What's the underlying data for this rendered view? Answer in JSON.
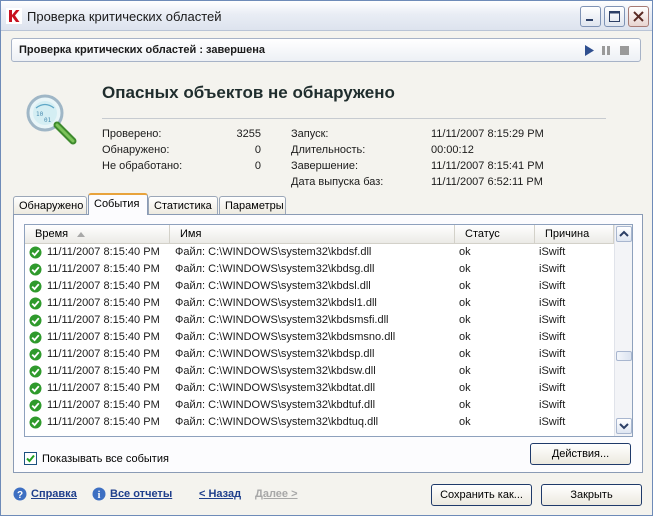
{
  "window": {
    "title": "Проверка критических областей"
  },
  "status": {
    "text": "Проверка критических областей : завершена"
  },
  "summary": {
    "headline": "Опасных объектов не обнаружено",
    "checked_label": "Проверено:",
    "checked_value": "3255",
    "found_label": "Обнаружено:",
    "found_value": "0",
    "unprocessed_label": "Не обработано:",
    "unprocessed_value": "0",
    "start_label": "Запуск:",
    "start_value": "11/11/2007 8:15:29 PM",
    "duration_label": "Длительность:",
    "duration_value": "00:00:12",
    "finish_label": "Завершение:",
    "finish_value": "11/11/2007 8:15:41 PM",
    "db_label": "Дата выпуска баз:",
    "db_value": "11/11/2007 6:52:11 PM"
  },
  "tabs": [
    {
      "label": "Обнаружено",
      "active": false
    },
    {
      "label": "События",
      "active": true
    },
    {
      "label": "Статистика",
      "active": false
    },
    {
      "label": "Параметры",
      "active": false
    }
  ],
  "table": {
    "columns": [
      "Время",
      "Имя",
      "Статус",
      "Причина"
    ],
    "rows": [
      {
        "time": "11/11/2007 8:15:40 PM",
        "name": "Файл: C:\\WINDOWS\\system32\\kbdsf.dll",
        "status": "ok",
        "reason": "iSwift"
      },
      {
        "time": "11/11/2007 8:15:40 PM",
        "name": "Файл: C:\\WINDOWS\\system32\\kbdsg.dll",
        "status": "ok",
        "reason": "iSwift"
      },
      {
        "time": "11/11/2007 8:15:40 PM",
        "name": "Файл: C:\\WINDOWS\\system32\\kbdsl.dll",
        "status": "ok",
        "reason": "iSwift"
      },
      {
        "time": "11/11/2007 8:15:40 PM",
        "name": "Файл: C:\\WINDOWS\\system32\\kbdsl1.dll",
        "status": "ok",
        "reason": "iSwift"
      },
      {
        "time": "11/11/2007 8:15:40 PM",
        "name": "Файл: C:\\WINDOWS\\system32\\kbdsmsfi.dll",
        "status": "ok",
        "reason": "iSwift"
      },
      {
        "time": "11/11/2007 8:15:40 PM",
        "name": "Файл: C:\\WINDOWS\\system32\\kbdsmsno.dll",
        "status": "ok",
        "reason": "iSwift"
      },
      {
        "time": "11/11/2007 8:15:40 PM",
        "name": "Файл: C:\\WINDOWS\\system32\\kbdsp.dll",
        "status": "ok",
        "reason": "iSwift"
      },
      {
        "time": "11/11/2007 8:15:40 PM",
        "name": "Файл: C:\\WINDOWS\\system32\\kbdsw.dll",
        "status": "ok",
        "reason": "iSwift"
      },
      {
        "time": "11/11/2007 8:15:40 PM",
        "name": "Файл: C:\\WINDOWS\\system32\\kbdtat.dll",
        "status": "ok",
        "reason": "iSwift"
      },
      {
        "time": "11/11/2007 8:15:40 PM",
        "name": "Файл: C:\\WINDOWS\\system32\\kbdtuf.dll",
        "status": "ok",
        "reason": "iSwift"
      },
      {
        "time": "11/11/2007 8:15:40 PM",
        "name": "Файл: C:\\WINDOWS\\system32\\kbdtuq.dll",
        "status": "ok",
        "reason": "iSwift"
      }
    ]
  },
  "options": {
    "show_all_events_label": "Показывать все события",
    "show_all_events_checked": true
  },
  "buttons": {
    "actions": "Действия...",
    "save_as": "Сохранить как...",
    "close": "Закрыть"
  },
  "links": {
    "help": "Справка",
    "all_reports": "Все отчеты",
    "back": "< Назад",
    "next": "Далее >"
  },
  "colors": {
    "ok_status": "#2f9a2c",
    "link": "#1f3f8c",
    "disabled": "#a8a8a8",
    "brand_red": "#c8101f"
  }
}
